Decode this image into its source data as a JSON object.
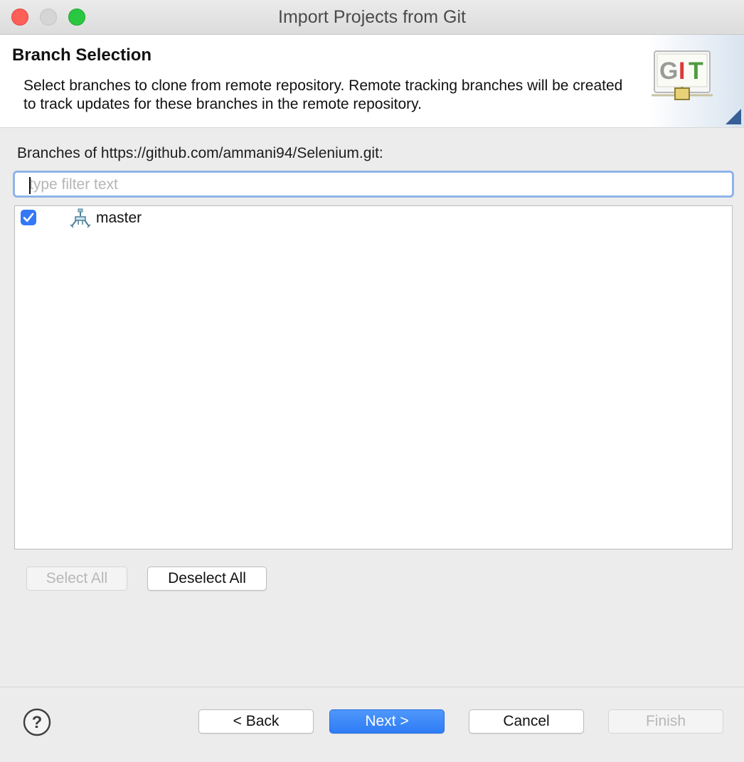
{
  "window": {
    "title": "Import Projects from Git"
  },
  "banner": {
    "title": "Branch Selection",
    "description": "Select branches to clone from remote repository. Remote tracking branches will be created to track updates for these branches in the remote repository.",
    "logo_text": "GIT",
    "logo_icon": "git-logo-icon"
  },
  "branches": {
    "label": "Branches of https://github.com/ammani94/Selenium.git:",
    "filter_placeholder": "type filter text",
    "filter_value": "",
    "items": [
      {
        "name": "master",
        "checked": true,
        "icon": "branch-icon"
      }
    ]
  },
  "selection_buttons": {
    "select_all": "Select All",
    "deselect_all": "Deselect All"
  },
  "footer": {
    "help_icon": "help-icon",
    "back": "< Back",
    "next": "Next >",
    "cancel": "Cancel",
    "finish": "Finish"
  },
  "colors": {
    "accent": "#2e7cf6",
    "focus_ring": "#8fb4ea",
    "close": "#fe5f57",
    "maximize": "#2ac840"
  }
}
